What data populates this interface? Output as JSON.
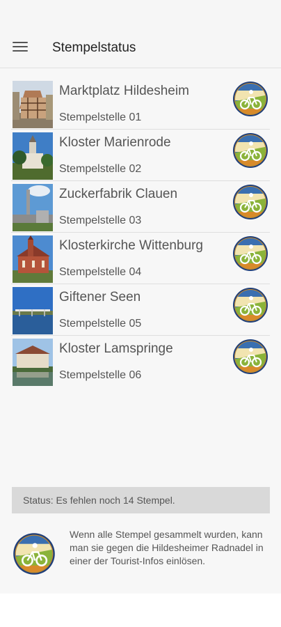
{
  "header": {
    "menu_icon": "hamburger-menu-icon",
    "title": "Stempelstatus"
  },
  "stations": [
    {
      "name": "Marktplatz Hildesheim",
      "subtitle": "Stempelstelle 01",
      "thumb": "half-timbered-house-photo",
      "badge": "cycling-stamp-badge-icon"
    },
    {
      "name": "Kloster Marienrode",
      "subtitle": "Stempelstelle 02",
      "thumb": "monastery-tower-photo",
      "badge": "cycling-stamp-badge-icon"
    },
    {
      "name": "Zuckerfabrik Clauen",
      "subtitle": "Stempelstelle 03",
      "thumb": "sugar-factory-chimney-photo",
      "badge": "cycling-stamp-badge-icon"
    },
    {
      "name": "Klosterkirche Wittenburg",
      "subtitle": "Stempelstelle 04",
      "thumb": "brick-church-photo",
      "badge": "cycling-stamp-badge-icon"
    },
    {
      "name": "Giftener Seen",
      "subtitle": "Stempelstelle 05",
      "thumb": "lake-bridge-photo",
      "badge": "cycling-stamp-badge-icon"
    },
    {
      "name": "Kloster Lamspringe",
      "subtitle": "Stempelstelle 06",
      "thumb": "monastery-pond-photo",
      "badge": "cycling-stamp-badge-icon"
    }
  ],
  "status": {
    "text": "Status: Es fehlen noch 14 Stempel."
  },
  "info": {
    "badge": "cycling-stamp-badge-icon",
    "text": "Wenn alle Stempel gesammelt wurden, kann man sie gegen die Hildesheimer Radnadel in einer der Tourist-Infos einlösen."
  },
  "colors": {
    "badge_sky": "#3a6fb0",
    "badge_field": "#8ab33a",
    "badge_ring": "#c98a2a",
    "status_bg": "#d9d9d9"
  }
}
